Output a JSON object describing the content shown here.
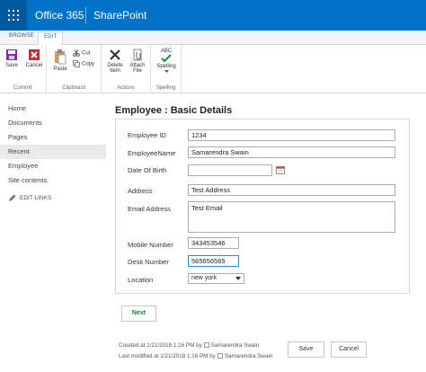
{
  "suite": {
    "brand": "Office 365",
    "app": "SharePoint"
  },
  "ribbon": {
    "tabs": [
      "BROWSE",
      "EDIT"
    ],
    "commit": {
      "save": "Save",
      "cancel": "Cancel",
      "label": "Commit"
    },
    "clipboard": {
      "paste": "Paste",
      "cut": "Cut",
      "copy": "Copy",
      "label": "Clipboard"
    },
    "actions": {
      "delete_item": "Delete Item",
      "attach_file": "Attach File",
      "label": "Actions"
    },
    "spelling": {
      "abc": "ABC",
      "spelling": "Spelling",
      "label": "Spelling"
    }
  },
  "leftnav": {
    "items": [
      "Home",
      "Documents",
      "Pages",
      "Recent",
      "Employee",
      "Site contents"
    ],
    "active": "Recent",
    "edit_links": "EDIT LINKS"
  },
  "form": {
    "title": "Employee : Basic Details",
    "fields": {
      "employee_id": {
        "label": "Employee ID",
        "value": "1234"
      },
      "employee_name": {
        "label": "EmployeeName",
        "value": "Samarendra Swain"
      },
      "dob": {
        "label": "Date Of Birth",
        "value": ""
      },
      "address": {
        "label": "Address",
        "value": "Test Address"
      },
      "email": {
        "label": "Email Address",
        "value": "Test Email"
      },
      "mobile": {
        "label": "Mobile Number",
        "value": "343453546"
      },
      "desk": {
        "label": "Desk Number",
        "value": "565656565"
      },
      "location": {
        "label": "Location",
        "value": "new york"
      }
    },
    "next": "Next"
  },
  "footer": {
    "created": "Created at 1/21/2018 1:16 PM  by",
    "created_by": "Samarendra Swain",
    "modified": "Last modified at 1/21/2018 1:16 PM  by",
    "modified_by": "Samarendra Swain",
    "save": "Save",
    "cancel": "Cancel"
  },
  "colors": {
    "suite_bar": "#0072c6",
    "accent": "#0072c6",
    "next_text": "#1a7f37"
  }
}
